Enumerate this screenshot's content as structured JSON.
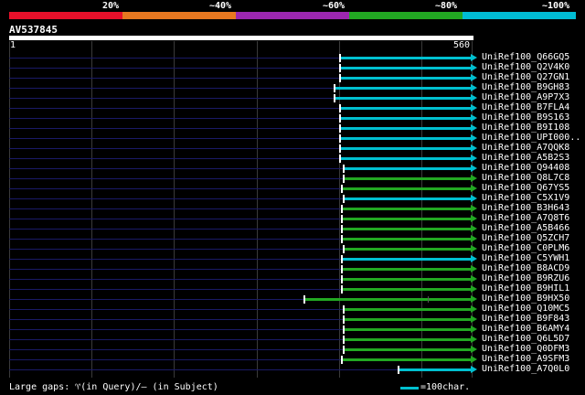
{
  "percent_bar": {
    "labels": [
      "20%",
      "~40%",
      "~60%",
      "~80%",
      "~100%"
    ],
    "colors": [
      "#e8102a",
      "#e87820",
      "#9c27b0",
      "#22a822",
      "#00bcd4"
    ]
  },
  "query": {
    "id": "AV537845",
    "start_label": "1",
    "end_label": "560"
  },
  "hits": [
    {
      "name": "UniRef100_Q66GQ5",
      "start": 372,
      "end": 515,
      "color": "#00c0d0"
    },
    {
      "name": "UniRef100_Q2V4K0",
      "start": 372,
      "end": 515,
      "color": "#00c0d0"
    },
    {
      "name": "UniRef100_Q27GN1",
      "start": 372,
      "end": 515,
      "color": "#00c0d0"
    },
    {
      "name": "UniRef100_B9GH83",
      "start": 366,
      "end": 515,
      "color": "#00c0d0"
    },
    {
      "name": "UniRef100_A9P7X3",
      "start": 366,
      "end": 515,
      "color": "#00c0d0"
    },
    {
      "name": "UniRef100_B7FLA4",
      "start": 372,
      "end": 515,
      "color": "#00c0d0"
    },
    {
      "name": "UniRef100_B9S163",
      "start": 372,
      "end": 515,
      "color": "#00c0d0"
    },
    {
      "name": "UniRef100_B9I108",
      "start": 372,
      "end": 515,
      "color": "#00c0d0"
    },
    {
      "name": "UniRef100_UPI000..",
      "start": 372,
      "end": 515,
      "color": "#00c0d0"
    },
    {
      "name": "UniRef100_A7QQK8",
      "start": 372,
      "end": 515,
      "color": "#00c0d0"
    },
    {
      "name": "UniRef100_A5B2S3",
      "start": 372,
      "end": 515,
      "color": "#00c0d0"
    },
    {
      "name": "UniRef100_Q94408",
      "start": 376,
      "end": 515,
      "color": "#00c0d0"
    },
    {
      "name": "UniRef100_Q8L7C8",
      "start": 376,
      "end": 515,
      "color": "#22a822"
    },
    {
      "name": "UniRef100_Q67YS5",
      "start": 374,
      "end": 515,
      "color": "#22a822"
    },
    {
      "name": "UniRef100_C5X1V9",
      "start": 376,
      "end": 515,
      "color": "#00c0d0"
    },
    {
      "name": "UniRef100_B3H643",
      "start": 374,
      "end": 515,
      "color": "#22a822"
    },
    {
      "name": "UniRef100_A7Q8T6",
      "start": 374,
      "end": 515,
      "color": "#22a822"
    },
    {
      "name": "UniRef100_A5B466",
      "start": 374,
      "end": 515,
      "color": "#22a822"
    },
    {
      "name": "UniRef100_Q5ZCH7",
      "start": 374,
      "end": 515,
      "color": "#22a822"
    },
    {
      "name": "UniRef100_C0PLM6",
      "start": 376,
      "end": 515,
      "color": "#22a822"
    },
    {
      "name": "UniRef100_C5YWH1",
      "start": 374,
      "end": 515,
      "color": "#00c0d0"
    },
    {
      "name": "UniRef100_B8ACD9",
      "start": 374,
      "end": 515,
      "color": "#22a822"
    },
    {
      "name": "UniRef100_B9RZU6",
      "start": 374,
      "end": 515,
      "color": "#22a822"
    },
    {
      "name": "UniRef100_B9HIL1",
      "start": 374,
      "end": 515,
      "color": "#22a822"
    },
    {
      "name": "UniRef100_B9HX50",
      "start": 333,
      "end": 515,
      "color": "#22a822",
      "gap": 468
    },
    {
      "name": "UniRef100_Q10MC5",
      "start": 376,
      "end": 515,
      "color": "#22a822"
    },
    {
      "name": "UniRef100_B9F843",
      "start": 376,
      "end": 515,
      "color": "#22a822"
    },
    {
      "name": "UniRef100_B6AMY4",
      "start": 376,
      "end": 515,
      "color": "#22a822"
    },
    {
      "name": "UniRef100_Q6L5D7",
      "start": 376,
      "end": 515,
      "color": "#22a822"
    },
    {
      "name": "UniRef100_Q0DFM3",
      "start": 376,
      "end": 515,
      "color": "#22a822"
    },
    {
      "name": "UniRef100_A9SFM3",
      "start": 374,
      "end": 515,
      "color": "#22a822"
    },
    {
      "name": "UniRef100_A7Q0L0",
      "start": 436,
      "end": 515,
      "color": "#00c0d0"
    }
  ],
  "legend": {
    "text": "Large gaps: ♈(in Query)/– (in Subject)",
    "scale_text": "=100char.",
    "scale_color": "#00c0d0"
  }
}
